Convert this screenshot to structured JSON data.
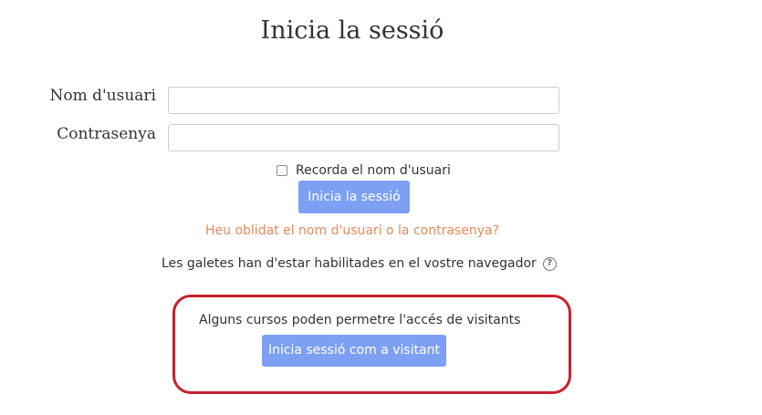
{
  "page": {
    "title": "Inicia la sessió"
  },
  "login_form": {
    "username_label": "Nom d'usuari",
    "username_value": "",
    "password_label": "Contrasenya",
    "password_value": "",
    "remember_label": "Recorda el nom d'usuari",
    "remember_checked": false,
    "login_button_label": "Inicia la sessió",
    "forgot_link_text": "Heu oblidat el nom d'usuari o la contrasenya?",
    "cookies_notice": "Les galetes han d'estar habilitades en el vostre navegador",
    "help_icon": "question-circle-icon"
  },
  "guest": {
    "notice": "Alguns cursos poden permetre l'accés de visitants",
    "button_label": "Inicia sessió com a visitant"
  },
  "colors": {
    "button": "#7da0f5",
    "link": "#e58a5a",
    "highlight_border": "#c8202f"
  }
}
